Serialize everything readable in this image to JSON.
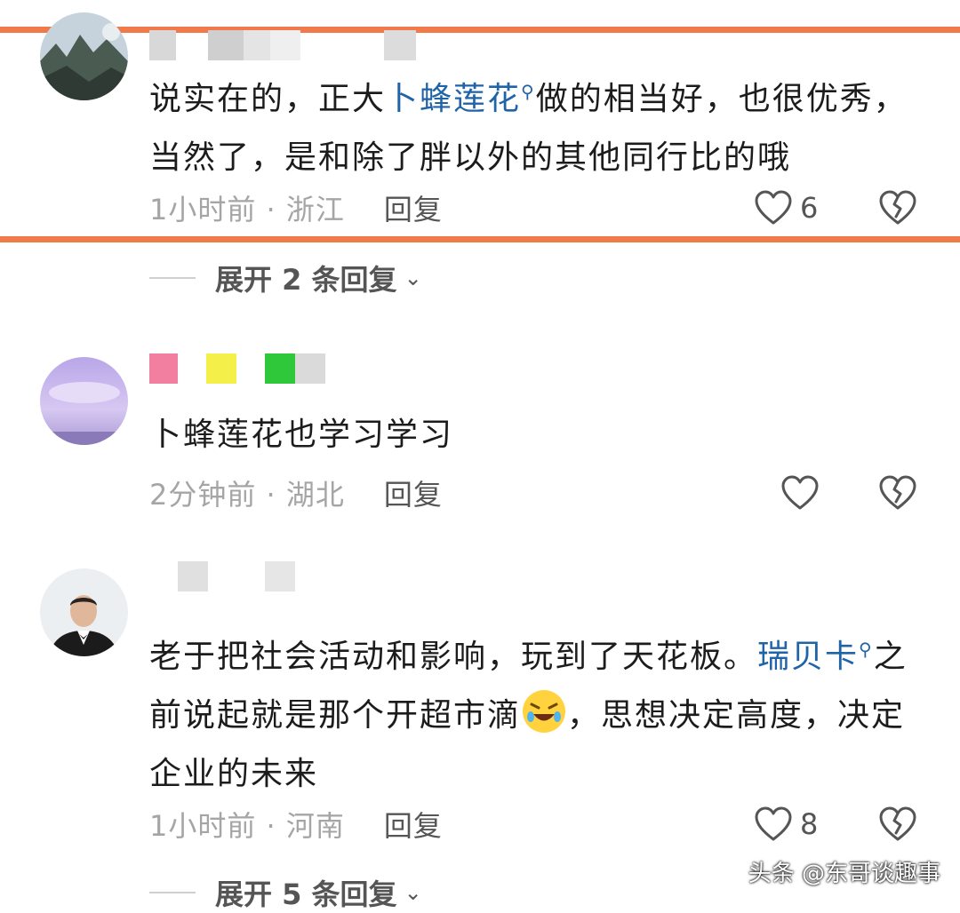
{
  "comments": [
    {
      "text_before": "说实在的，正大",
      "link_text": "卜蜂莲花",
      "text_after": "做的相当好，也很优秀，当然了，是和除了胖以外的其他同行比的哦",
      "time": "1小时前",
      "location": "浙江",
      "reply_label": "回复",
      "like_count": "6",
      "expand_label": "展开 2 条回复"
    },
    {
      "text": "卜蜂莲花也学习学习",
      "time": "2分钟前",
      "location": "湖北",
      "reply_label": "回复",
      "like_count": ""
    },
    {
      "text_before": "老于把社会活动和影响，玩到了天花板。",
      "link_text": "瑞贝卡",
      "text_mid": "之前说起就是那个开超市滴",
      "text_after": "，思想决定高度，决定企业的未来",
      "time": "1小时前",
      "location": "河南",
      "reply_label": "回复",
      "like_count": "8",
      "expand_label": "展开 5 条回复"
    }
  ],
  "meta_separator": " · ",
  "watermark": "头条 @东哥谈趣事",
  "colors": {
    "highlight": "#f07a4a",
    "link": "#1f63a8",
    "meta": "#a5a5a5"
  },
  "icons": [
    "heart-icon",
    "broken-heart-icon",
    "search-icon",
    "chevron-down-icon",
    "laughing-emoji-icon"
  ]
}
